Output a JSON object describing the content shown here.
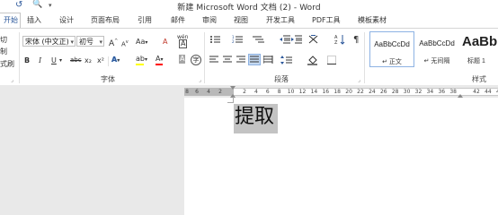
{
  "title_bar": {
    "title": "新建 Microsoft Word 文档 (2) - Word",
    "undo_icon": "undo-icon",
    "preview_icon": "print-preview-icon",
    "more_icon": "qat-more-icon"
  },
  "tabs": [
    {
      "label": "开始"
    },
    {
      "label": "插入"
    },
    {
      "label": "设计"
    },
    {
      "label": "页面布局"
    },
    {
      "label": "引用"
    },
    {
      "label": "邮件"
    },
    {
      "label": "审阅"
    },
    {
      "label": "视图"
    },
    {
      "label": "开发工具"
    },
    {
      "label": "PDF工具"
    },
    {
      "label": "模板素材"
    }
  ],
  "clipboard": {
    "cut_label": "切",
    "copy_label": "制",
    "format_painter_label": "式刷"
  },
  "font": {
    "font_name": "宋体 (中文正)",
    "font_size": "初号",
    "group_label": "字体",
    "grow_label": "A",
    "shrink_label": "A",
    "case_label": "Aa",
    "clear_label": "A",
    "phonetic_label": "wén",
    "border_label": "A",
    "bold_label": "B",
    "italic_label": "I",
    "underline_label": "U",
    "strike_label": "abc",
    "subscript_label": "x₂",
    "superscript_label": "x²",
    "effects_label": "A",
    "highlight_label": "ab",
    "color_label": "A",
    "shading_label": "A",
    "enclose_label": "字"
  },
  "paragraph": {
    "group_label": "段落",
    "show_marks_label": "¶"
  },
  "styles": {
    "group_label": "样式",
    "items": [
      {
        "sample": "AaBbCcDd",
        "name": "↵ 正文"
      },
      {
        "sample": "AaBbCcDd",
        "name": "↵ 无间隔"
      },
      {
        "sample": "AaBb",
        "name": "标题 1"
      }
    ]
  },
  "ruler": {
    "left_numbers": [
      "8",
      "6",
      "4",
      "2"
    ],
    "right_numbers": [
      "2",
      "4",
      "6",
      "8",
      "10",
      "12",
      "14",
      "16",
      "18",
      "20",
      "22",
      "24",
      "26",
      "28",
      "30",
      "32",
      "34",
      "36",
      "38",
      "42",
      "44",
      "46"
    ]
  },
  "document": {
    "text": "提取"
  },
  "colors": {
    "accent": "#2b579a",
    "highlight": "#ffff00",
    "font_color": "#ff0000",
    "selection": "#c3c3c3"
  }
}
